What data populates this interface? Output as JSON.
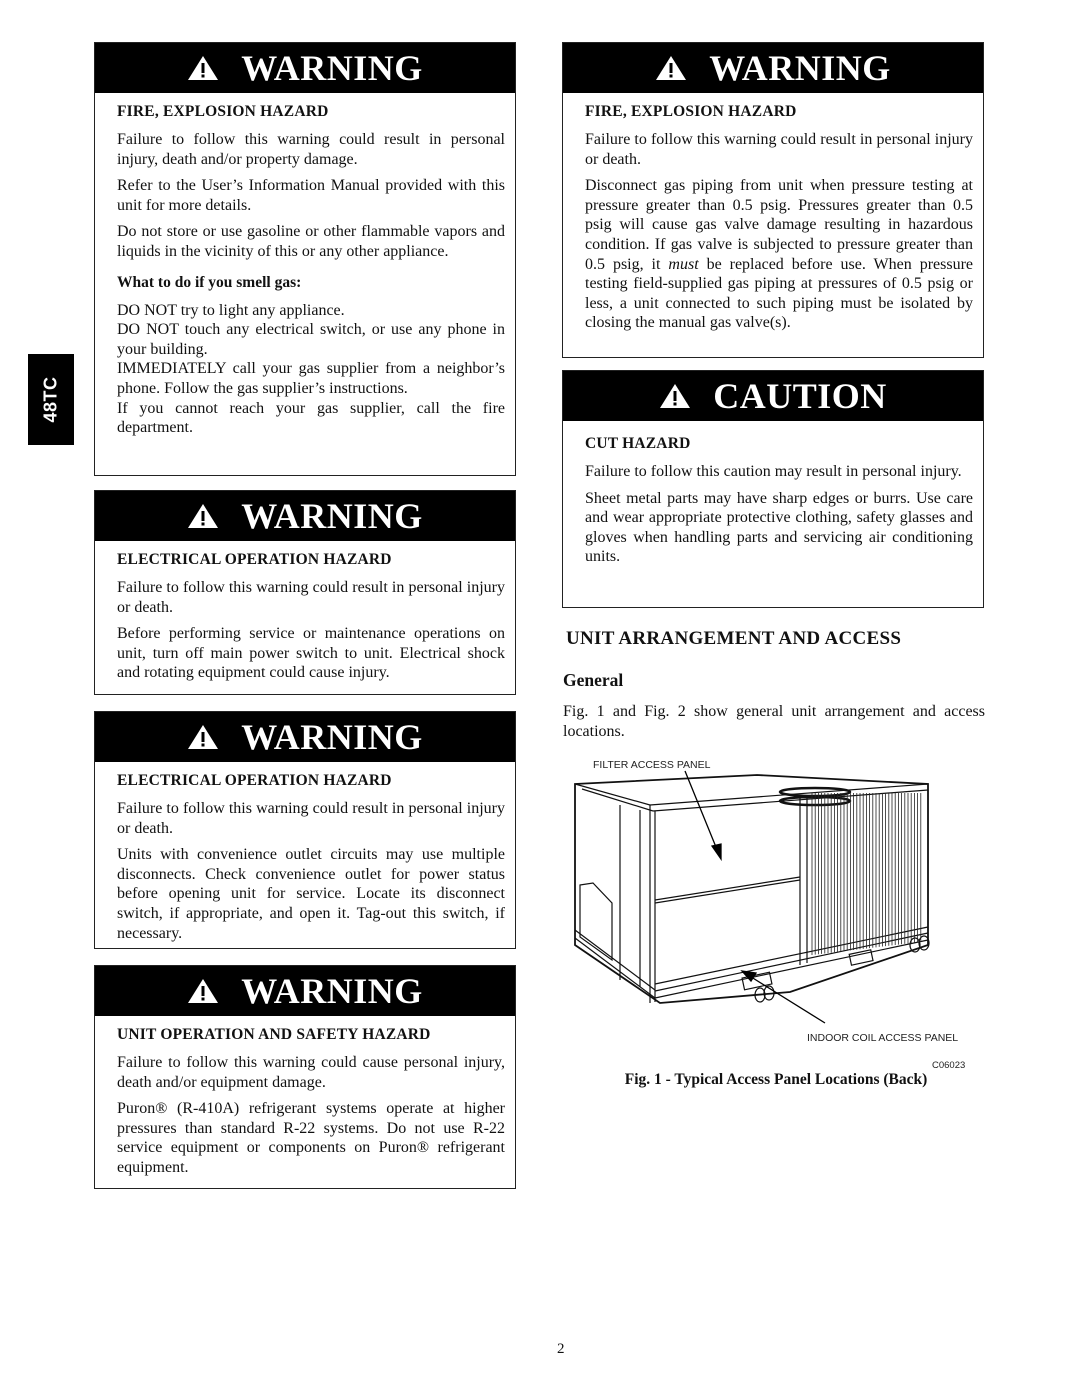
{
  "side_tab": {
    "label": "48TC"
  },
  "left_column": {
    "boxes": [
      {
        "signal_word": "WARNING",
        "icon": "warning-triangle-icon",
        "hazard": "FIRE, EXPLOSION HAZARD",
        "paragraphs": [
          "Failure to follow this warning could result in personal injury, death and/or property damage.",
          "Refer to the User’s Information Manual provided with this unit for more details.",
          "Do not store or use gasoline or other flammable vapors and liquids in the vicinity of this or any other appliance."
        ],
        "subheading": "What to do if you smell gas:",
        "instructions": [
          "DO NOT try to light any appliance.",
          "DO NOT touch any electrical switch, or use any phone in your building.",
          "IMMEDIATELY call your gas supplier from a neighbor’s phone. Follow the gas supplier’s instructions.",
          "If you cannot reach your gas supplier, call the fire department."
        ]
      },
      {
        "signal_word": "WARNING",
        "icon": "warning-triangle-icon",
        "hazard": "ELECTRICAL OPERATION HAZARD",
        "paragraphs": [
          "Failure to follow this warning could result in personal injury or death.",
          "Before performing service or maintenance operations on unit, turn off main power switch to unit. Electrical shock and rotating equipment could cause injury."
        ]
      },
      {
        "signal_word": "WARNING",
        "icon": "warning-triangle-icon",
        "hazard": "ELECTRICAL OPERATION HAZARD",
        "paragraphs": [
          "Failure to follow this warning could result in personal injury or death.",
          "Units with convenience outlet circuits may use multiple disconnects. Check convenience outlet for power status before opening unit for service. Locate its disconnect switch, if appropriate, and open it. Tag-out this switch, if necessary."
        ]
      },
      {
        "signal_word": "WARNING",
        "icon": "warning-triangle-icon",
        "hazard": "UNIT OPERATION AND SAFETY HAZARD",
        "paragraphs": [
          "Failure to follow this warning could cause personal injury, death and/or equipment damage.",
          "Puron® (R-410A) refrigerant systems operate at higher pressures than standard R-22 systems. Do not use R-22 service equipment or components on Puron® refrigerant equipment."
        ]
      }
    ]
  },
  "right_column": {
    "boxes": [
      {
        "signal_word": "WARNING",
        "icon": "warning-triangle-icon",
        "hazard": "FIRE, EXPLOSION HAZARD",
        "paragraphs": [
          "Failure to follow this warning could result in personal injury or death.",
          "Disconnect gas piping from unit when pressure testing at pressure greater than 0.5 psig. Pressures greater than 0.5 psig will cause gas valve damage resulting in hazardous condition. If gas valve is subjected to pressure greater than 0.5 psig, it must be replaced before use. When pressure testing field-supplied gas piping at pressures of 0.5 psig or less, a unit connected to such piping must be isolated by closing the manual gas valve(s)."
        ]
      },
      {
        "signal_word": "CAUTION",
        "icon": "warning-triangle-icon",
        "hazard": "CUT HAZARD",
        "paragraphs": [
          "Failure to follow this caution may result in personal injury.",
          "Sheet metal parts may have sharp edges or burrs. Use care and wear appropriate protective clothing, safety glasses and gloves when handling parts and servicing air conditioning units."
        ]
      }
    ],
    "section_title": "UNIT ARRANGEMENT AND ACCESS",
    "subsection_title": "General",
    "intro": "Fig. 1 and Fig. 2 show general unit arrangement and access locations.",
    "figure": {
      "labels": {
        "filter": "FILTER ACCESS PANEL",
        "indoor_coil": "INDOOR COIL ACCESS PANEL",
        "code": "C06023"
      },
      "caption": "Fig. 1 - Typical Access Panel Locations (Back)"
    }
  },
  "page_number": "2"
}
